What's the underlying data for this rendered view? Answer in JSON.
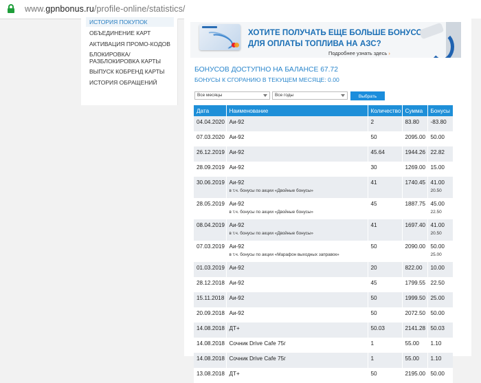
{
  "browser": {
    "url_prefix": "www.",
    "url_domain": "gpnbonus.ru",
    "url_path": "/profile-online/statistics/"
  },
  "sidebar": {
    "items": [
      {
        "label": "ИСТОРИЯ ПОКУПОК",
        "active": true
      },
      {
        "label": "ОБЪЕДИНЕНИЕ КАРТ"
      },
      {
        "label": "АКТИВАЦИЯ ПРОМО-КОДОВ"
      },
      {
        "label": "БЛОКИРОВКА/",
        "label2": "РАЗБЛОКИРОВКА КАРТЫ"
      },
      {
        "label": "ВЫПУСК КОБРЕНД КАРТЫ"
      },
      {
        "label": "ИСТОРИЯ ОБРАЩЕНИЙ"
      }
    ]
  },
  "banner": {
    "line1": "ХОТИТЕ ПОЛУЧАТЬ ЕЩЕ БОЛЬШЕ БОНУСОВ",
    "line2": "ДЛЯ ОПЛАТЫ ТОПЛИВА НА АЗС?",
    "more": "Подробнее узнать здесь",
    "more_arrow": "›"
  },
  "balance": {
    "available": "БОНУСОВ ДОСТУПНО НА БАЛАНСЕ 67.72",
    "expiring": "БОНУСЫ К СГОРАНИЮ В ТЕКУЩЕМ МЕСЯЦЕ: 0.00"
  },
  "filters": {
    "month": "Все месяцы",
    "year": "Все годы",
    "submit": "Выбрать"
  },
  "table": {
    "headers": [
      "Дата",
      "Наименование",
      "Количество",
      "Сумма",
      "Бонусы"
    ],
    "rows": [
      {
        "date": "04.04.2020",
        "name": "Аи-92",
        "qty": "2",
        "sum": "83.80",
        "bonus": "-83.80"
      },
      {
        "date": "07.03.2020",
        "name": "Аи-92",
        "qty": "50",
        "sum": "2095.00",
        "bonus": "50.00"
      },
      {
        "date": "26.12.2019",
        "name": "Аи-92",
        "qty": "45.64",
        "sum": "1944.26",
        "bonus": "22.82"
      },
      {
        "date": "28.09.2019",
        "name": "Аи-92",
        "qty": "30",
        "sum": "1269.00",
        "bonus": "15.00"
      },
      {
        "date": "30.06.2019",
        "name": "Аи-92",
        "sub": "в т.ч. бонусы по акции «Двойные бонусы»",
        "qty": "41",
        "sum": "1740.45",
        "bonus": "41.00",
        "sub_bonus": "20.50"
      },
      {
        "date": "28.05.2019",
        "name": "Аи-92",
        "sub": "в т.ч. бонусы по акции «Двойные бонусы»",
        "qty": "45",
        "sum": "1887.75",
        "bonus": "45.00",
        "sub_bonus": "22.50"
      },
      {
        "date": "08.04.2019",
        "name": "Аи-92",
        "sub": "в т.ч. бонусы по акции «Двойные бонусы»",
        "qty": "41",
        "sum": "1697.40",
        "bonus": "41.00",
        "sub_bonus": "20.50"
      },
      {
        "date": "07.03.2019",
        "name": "Аи-92",
        "sub": "в т.ч. бонусы по акции «Марафон выходных заправок»",
        "qty": "50",
        "sum": "2090.00",
        "bonus": "50.00",
        "sub_bonus": "25.00"
      },
      {
        "date": "01.03.2019",
        "name": "Аи-92",
        "qty": "20",
        "sum": "822.00",
        "bonus": "10.00"
      },
      {
        "date": "28.12.2018",
        "name": "Аи-92",
        "qty": "45",
        "sum": "1799.55",
        "bonus": "22.50"
      },
      {
        "date": "15.11.2018",
        "name": "Аи-92",
        "qty": "50",
        "sum": "1999.50",
        "bonus": "25.00"
      },
      {
        "date": "20.09.2018",
        "name": "Аи-92",
        "qty": "50",
        "sum": "2072.50",
        "bonus": "50.00"
      },
      {
        "date": "14.08.2018",
        "name": "ДТ+",
        "qty": "50.03",
        "sum": "2141.28",
        "bonus": "50.03"
      },
      {
        "date": "14.08.2018",
        "name": "Сочник Drive Cafe 75г",
        "qty": "1",
        "sum": "55.00",
        "bonus": "1.10"
      },
      {
        "date": "14.08.2018",
        "name": "Сочник Drive Cafe 75г",
        "qty": "1",
        "sum": "55.00",
        "bonus": "1.10"
      },
      {
        "date": "13.08.2018",
        "name": "ДТ+",
        "qty": "50",
        "sum": "2195.00",
        "bonus": "50.00"
      }
    ]
  }
}
